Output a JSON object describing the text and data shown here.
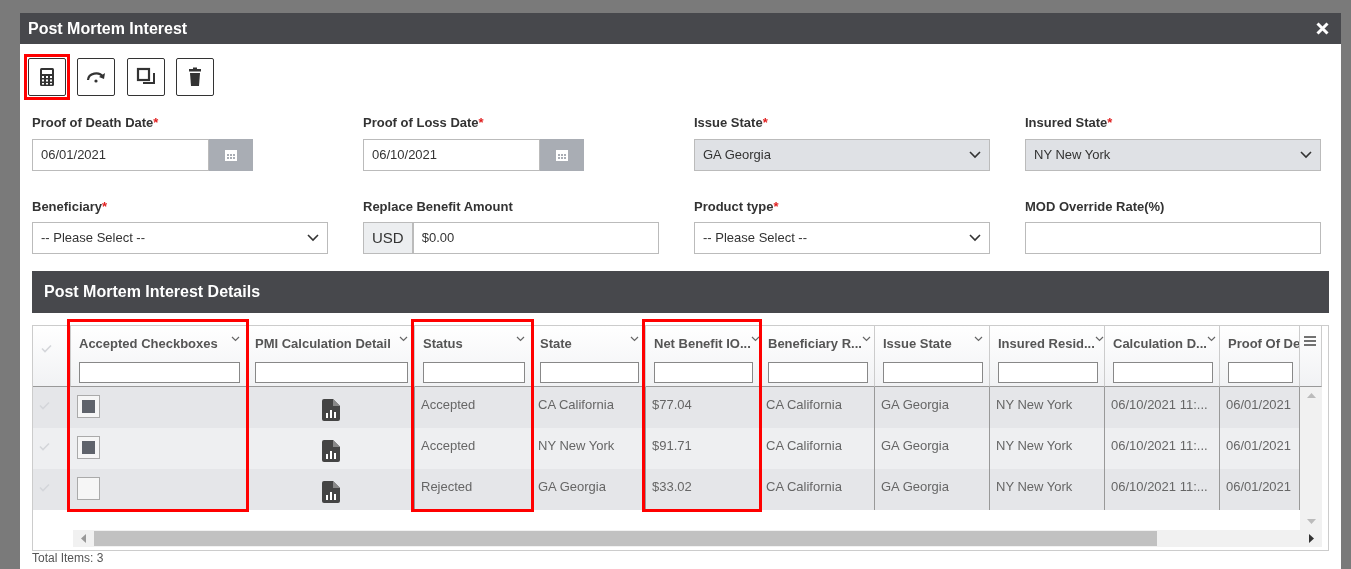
{
  "window": {
    "title": "Post Mortem Interest"
  },
  "toolbar": [
    {
      "highlighted": true
    },
    {
      "highlighted": false
    },
    {
      "highlighted": false
    },
    {
      "highlighted": false
    }
  ],
  "fields": [
    {
      "kind": "date",
      "label": "Proof of Death Date",
      "required_mark": "*",
      "value": "06/01/2021"
    },
    {
      "kind": "date",
      "label": "Proof of Loss Date",
      "required_mark": "*",
      "value": "06/10/2021"
    },
    {
      "kind": "select",
      "label": "Issue State",
      "required_mark": "*",
      "value": "GA Georgia",
      "disabled": true
    },
    {
      "kind": "select",
      "label": "Insured State",
      "required_mark": "*",
      "value": "NY New York",
      "disabled": true
    },
    {
      "kind": "select",
      "label": "Beneficiary",
      "required_mark": "*",
      "value": "-- Please Select --",
      "disabled": false
    },
    {
      "kind": "currency",
      "label": "Replace Benefit Amount",
      "prefix": "USD",
      "value": "$0.00"
    },
    {
      "kind": "select",
      "label": "Product type",
      "required_mark": "*",
      "value": "-- Please Select --",
      "disabled": false
    },
    {
      "kind": "text",
      "label": "MOD Override Rate(%)"
    }
  ],
  "details": {
    "title": "Post Mortem Interest Details",
    "columns": [
      {
        "label": "Accepted Checkboxes",
        "highlighted": true
      },
      {
        "label": "PMI Calculation Detail",
        "highlighted": false
      },
      {
        "label": "Status",
        "highlighted": true
      },
      {
        "label": "State",
        "highlighted": false
      },
      {
        "label": "Net Benefit IO...",
        "highlighted": true
      },
      {
        "label": "Beneficiary R...",
        "highlighted": false
      },
      {
        "label": "Issue State",
        "highlighted": false
      },
      {
        "label": "Insured Resid...",
        "highlighted": false
      },
      {
        "label": "Calculation D...",
        "highlighted": false
      },
      {
        "label": "Proof Of De",
        "highlighted": false
      }
    ],
    "rows": [
      {
        "checked": true,
        "cells": [
          "",
          "",
          "Accepted",
          "CA California",
          "$77.04",
          "CA California",
          "GA Georgia",
          "NY New York",
          "06/10/2021 11:...",
          "06/01/2021"
        ]
      },
      {
        "checked": true,
        "cells": [
          "",
          "",
          "Accepted",
          "NY New York",
          "$91.71",
          "CA California",
          "GA Georgia",
          "NY New York",
          "06/10/2021 11:...",
          "06/01/2021"
        ]
      },
      {
        "checked": false,
        "cells": [
          "",
          "",
          "Rejected",
          "GA Georgia",
          "$33.02",
          "CA California",
          "GA Georgia",
          "NY New York",
          "06/10/2021 11:...",
          "06/01/2021"
        ]
      }
    ],
    "total": "Total Items: 3"
  }
}
